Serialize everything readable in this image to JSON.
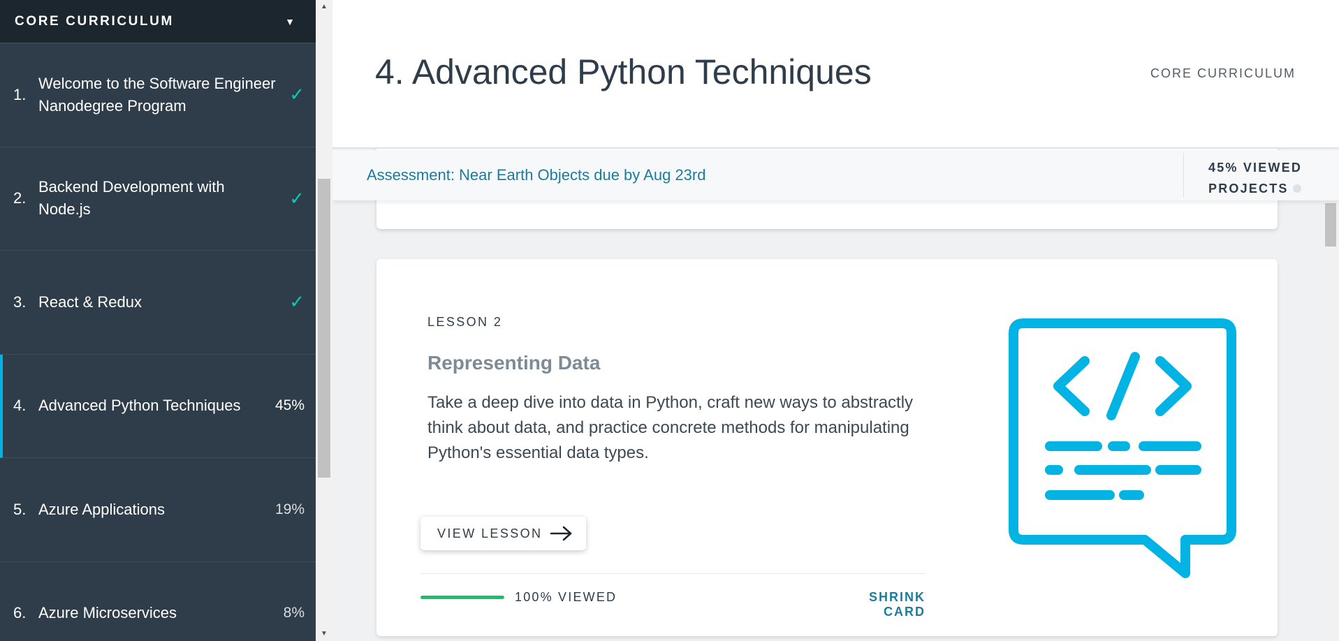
{
  "sidebar": {
    "header_title": "CORE CURRICULUM",
    "items": [
      {
        "number": "1.",
        "label": "Welcome to the Software Engineer Nanodegree Program",
        "status": "✓"
      },
      {
        "number": "2.",
        "label": "Backend Development with Node.js",
        "status": "✓"
      },
      {
        "number": "3.",
        "label": "React & Redux",
        "status": "✓"
      },
      {
        "number": "4.",
        "label": "Advanced Python Techniques",
        "status": "45%"
      },
      {
        "number": "5.",
        "label": "Azure Applications",
        "status": "19%"
      },
      {
        "number": "6.",
        "label": "Azure Microservices",
        "status": "8%"
      }
    ]
  },
  "header": {
    "title": "4. Advanced Python Techniques",
    "course": "CORE CURRICULUM"
  },
  "assessment": {
    "link": "Assessment: Near Earth Objects due by Aug 23rd",
    "viewed_line1": "45% VIEWED",
    "viewed_line2": "PROJECTS"
  },
  "lesson_card": {
    "kicker": "LESSON 2",
    "title": "Representing Data",
    "description": "Take a deep dive into data in Python, craft new ways to abstractly think about data, and practice concrete methods for manipulating Python's essential data types.",
    "button_label": "VIEW LESSON",
    "progress_text": "100% VIEWED",
    "progress_fraction": 1.0,
    "shrink_label": "SHRINK CARD",
    "icon": "code-chat-icon"
  },
  "colors": {
    "sidebar_bg": "#2e3d49",
    "accent": "#02b3e4",
    "check": "#02ccba",
    "progress": "#15c26b",
    "link": "#1a7c9e"
  }
}
